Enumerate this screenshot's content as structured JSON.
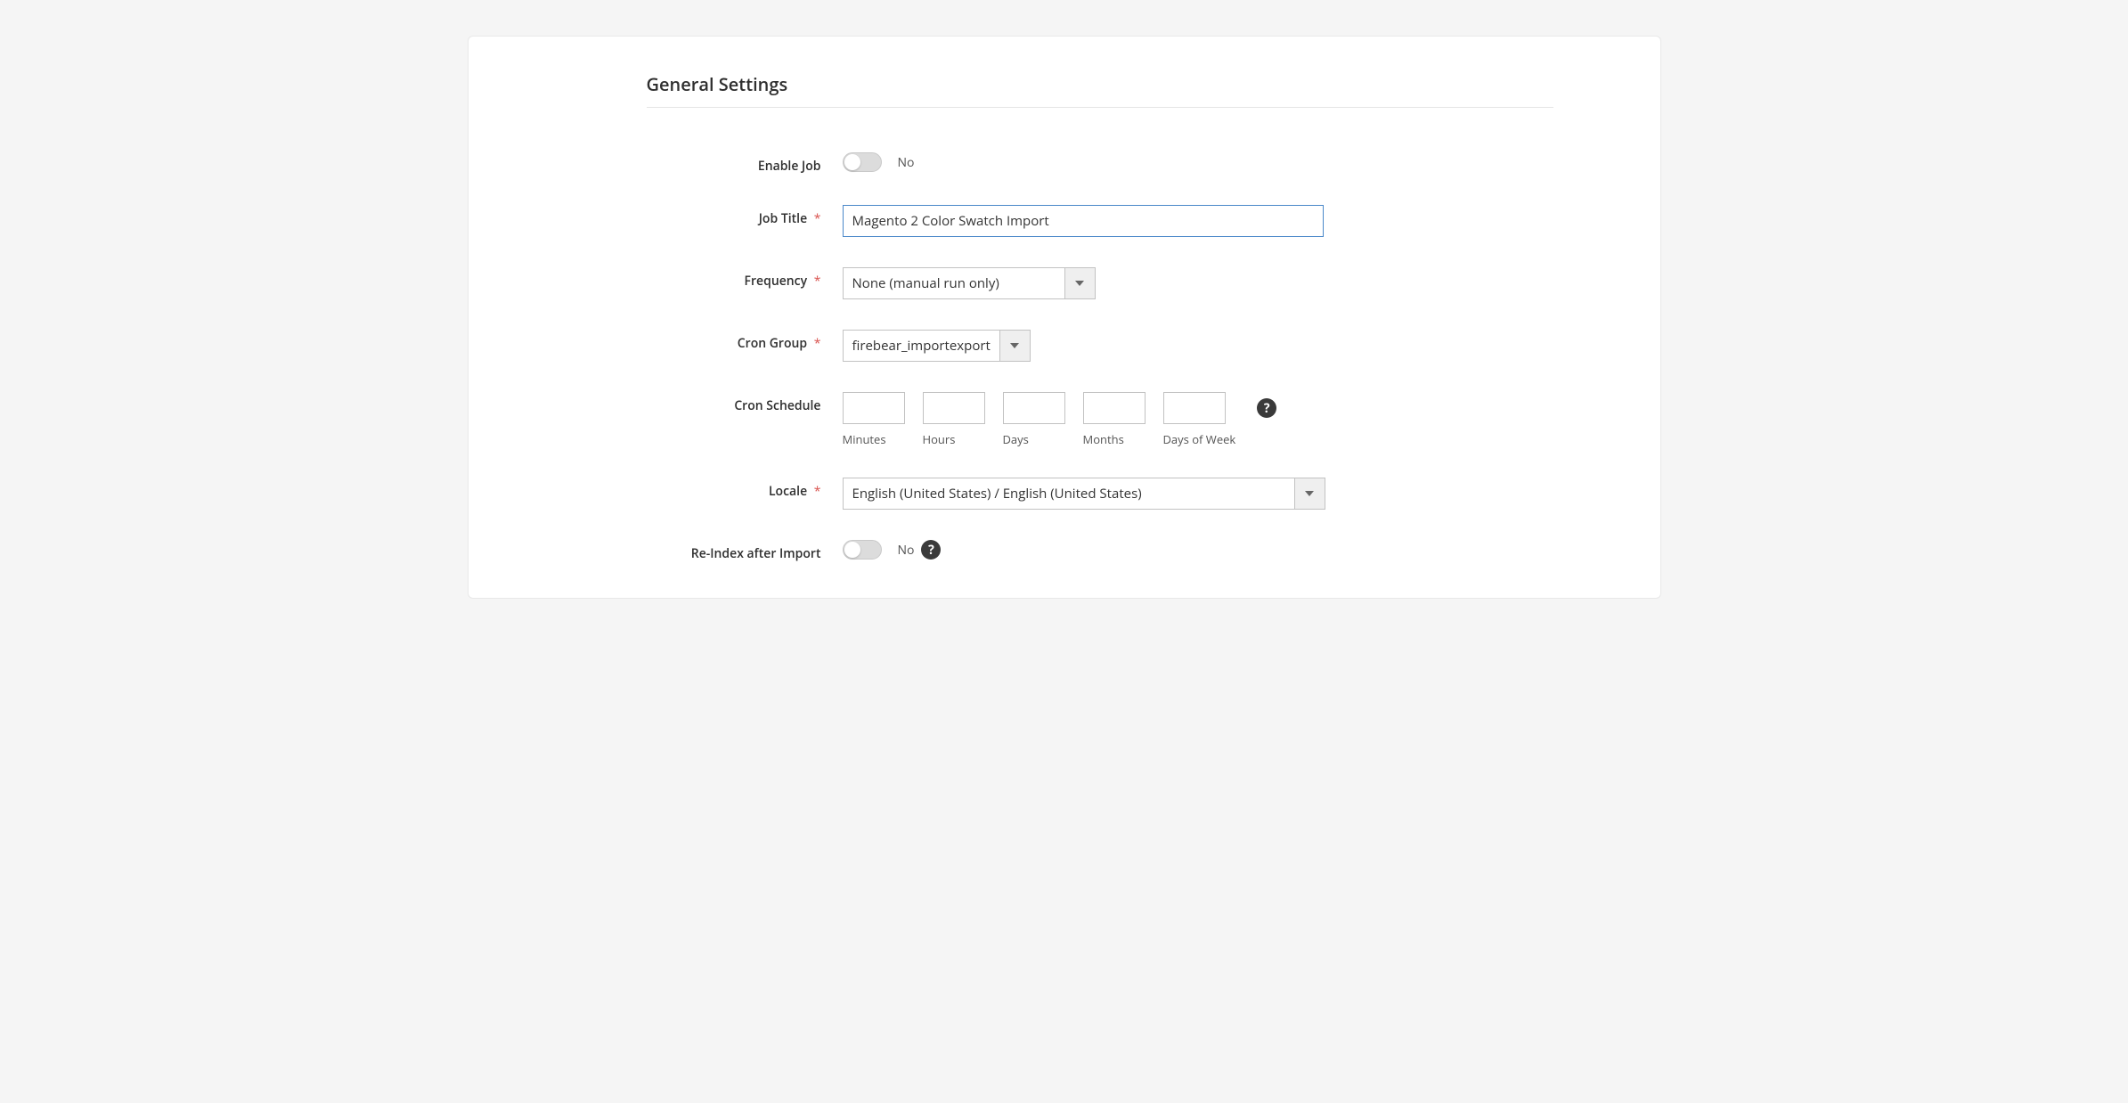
{
  "section_title": "General Settings",
  "fields": {
    "enable_job": {
      "label": "Enable Job",
      "value_text": "No"
    },
    "job_title": {
      "label": "Job Title",
      "value": "Magento 2 Color Swatch Import"
    },
    "frequency": {
      "label": "Frequency",
      "value": "None (manual run only)"
    },
    "cron_group": {
      "label": "Cron Group",
      "value": "firebear_importexport"
    },
    "cron_schedule": {
      "label": "Cron Schedule",
      "parts": {
        "minutes": "Minutes",
        "hours": "Hours",
        "days": "Days",
        "months": "Months",
        "dow": "Days of Week"
      }
    },
    "locale": {
      "label": "Locale",
      "value": "English (United States) / English (United States)"
    },
    "reindex": {
      "label": "Re-Index after Import",
      "value_text": "No"
    }
  },
  "glyphs": {
    "required": "*",
    "help": "?"
  }
}
